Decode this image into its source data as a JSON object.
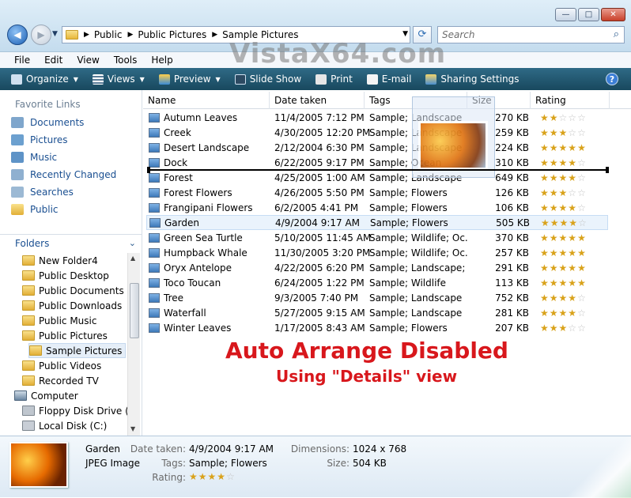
{
  "window": {
    "minimize_glyph": "—",
    "maximize_glyph": "□",
    "close_glyph": "✕"
  },
  "address": {
    "crumbs": [
      "Public",
      "Public Pictures",
      "Sample Pictures"
    ],
    "search_placeholder": "Search"
  },
  "menu": [
    "File",
    "Edit",
    "View",
    "Tools",
    "Help"
  ],
  "watermark": "VistaX64.com",
  "toolbar": {
    "organize": "Organize",
    "views": "Views",
    "preview": "Preview",
    "slideshow": "Slide Show",
    "print": "Print",
    "email": "E-mail",
    "sharing": "Sharing Settings",
    "help": "?"
  },
  "sidebar": {
    "fav_title": "Favorite Links",
    "favorites": [
      "Documents",
      "Pictures",
      "Music",
      "Recently Changed",
      "Searches",
      "Public"
    ],
    "folders_title": "Folders",
    "tree": [
      "New Folder4",
      "Public Desktop",
      "Public Documents",
      "Public Downloads",
      "Public Music",
      "Public Pictures",
      "Sample Pictures",
      "Public Videos",
      "Recorded TV",
      "Computer",
      "Floppy Disk Drive (A:",
      "Local Disk (C:)"
    ]
  },
  "columns": [
    "Name",
    "Date taken",
    "Tags",
    "Size",
    "Rating"
  ],
  "files": [
    {
      "name": "Autumn Leaves",
      "date": "11/4/2005 7:12 PM",
      "tags": "Sample; Landscape",
      "size": "270 KB",
      "rating": 2
    },
    {
      "name": "Creek",
      "date": "4/30/2005 12:20 PM",
      "tags": "Sample; Landscape",
      "size": "259 KB",
      "rating": 3
    },
    {
      "name": "Desert Landscape",
      "date": "2/12/2004 6:30 PM",
      "tags": "Sample; Landscape",
      "size": "224 KB",
      "rating": 5
    },
    {
      "name": "Dock",
      "date": "6/22/2005 9:17 PM",
      "tags": "Sample; Ocean",
      "size": "310 KB",
      "rating": 4
    },
    {
      "name": "Forest",
      "date": "4/25/2005 1:00 AM",
      "tags": "Sample; Landscape",
      "size": "649 KB",
      "rating": 4
    },
    {
      "name": "Forest Flowers",
      "date": "4/26/2005 5:50 PM",
      "tags": "Sample; Flowers",
      "size": "126 KB",
      "rating": 3
    },
    {
      "name": "Frangipani Flowers",
      "date": "6/2/2005 4:41 PM",
      "tags": "Sample; Flowers",
      "size": "106 KB",
      "rating": 4
    },
    {
      "name": "Garden",
      "date": "4/9/2004 9:17 AM",
      "tags": "Sample; Flowers",
      "size": "505 KB",
      "rating": 4
    },
    {
      "name": "Green Sea Turtle",
      "date": "5/10/2005 11:45 AM",
      "tags": "Sample; Wildlife; Oc...",
      "size": "370 KB",
      "rating": 5
    },
    {
      "name": "Humpback Whale",
      "date": "11/30/2005 3:20 PM",
      "tags": "Sample; Wildlife; Oc...",
      "size": "257 KB",
      "rating": 5
    },
    {
      "name": "Oryx Antelope",
      "date": "4/22/2005 6:20 PM",
      "tags": "Sample; Landscape; ...",
      "size": "291 KB",
      "rating": 5
    },
    {
      "name": "Toco Toucan",
      "date": "6/24/2005 1:22 PM",
      "tags": "Sample; Wildlife",
      "size": "113 KB",
      "rating": 5
    },
    {
      "name": "Tree",
      "date": "9/3/2005 7:40 PM",
      "tags": "Sample; Landscape",
      "size": "752 KB",
      "rating": 4
    },
    {
      "name": "Waterfall",
      "date": "5/27/2005 9:15 AM",
      "tags": "Sample; Landscape",
      "size": "281 KB",
      "rating": 4
    },
    {
      "name": "Winter Leaves",
      "date": "1/17/2005 8:43 AM",
      "tags": "Sample; Flowers",
      "size": "207 KB",
      "rating": 3
    }
  ],
  "selected_index": 7,
  "overlay": {
    "line1": "Auto Arrange Disabled",
    "line2": "Using \"Details\" view"
  },
  "details": {
    "name": "Garden",
    "type": "JPEG Image",
    "date_label": "Date taken:",
    "date": "4/9/2004 9:17 AM",
    "tags_label": "Tags:",
    "tags": "Sample; Flowers",
    "rating_label": "Rating:",
    "rating": 4,
    "dim_label": "Dimensions:",
    "dimensions": "1024 x 768",
    "size_label": "Size:",
    "size": "504 KB"
  },
  "colors": {
    "toolbar": "#1f5470",
    "link": "#1a4f91",
    "overlay_text": "#d8171c",
    "star_on": "#d9a21a"
  }
}
